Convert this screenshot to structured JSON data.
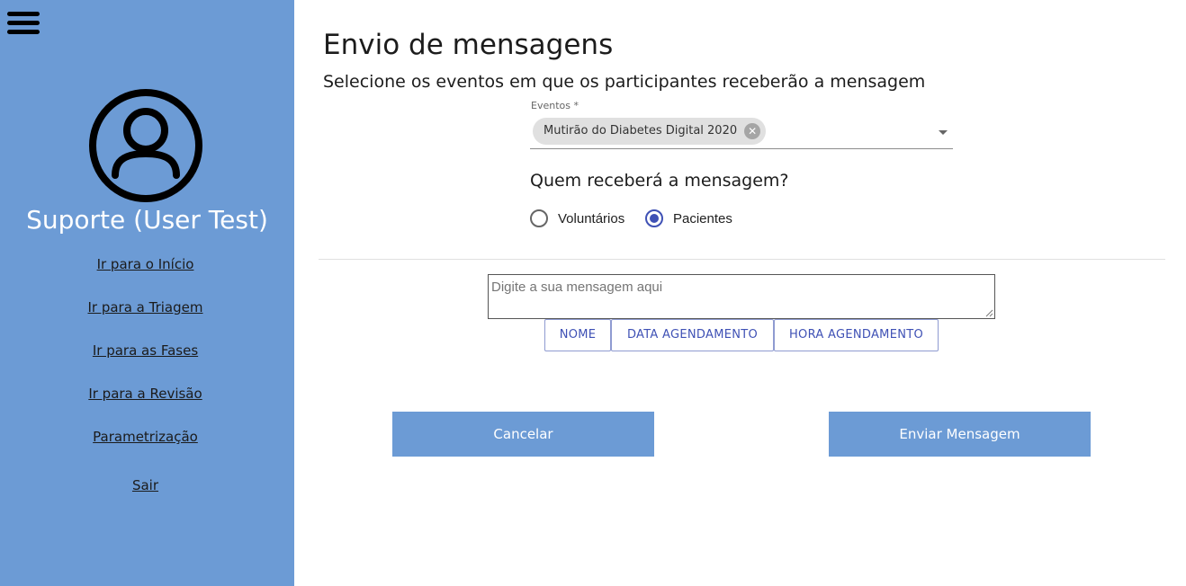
{
  "sidebar": {
    "user_name": "Suporte (User Test)",
    "links": {
      "home": "Ir para o Início",
      "triage": "Ir para a Triagem",
      "phases": "Ir para as Fases",
      "review": "Ir para a Revisão",
      "settings": "Parametrização",
      "logout": "Sair"
    }
  },
  "main": {
    "title": "Envio de mensagens",
    "subtitle": "Selecione os eventos em que os participantes receberão a mensagem",
    "events": {
      "label": "Eventos *",
      "selected": "Mutirão do Diabetes Digital 2020"
    },
    "recipients": {
      "question": "Quem receberá a mensagem?",
      "options": [
        "Voluntários",
        "Pacientes"
      ],
      "selected": "Pacientes"
    },
    "message": {
      "placeholder": "Digite a sua mensagem aqui",
      "value": ""
    },
    "tags": [
      "NOME",
      "DATA AGENDAMENTO",
      "HORA AGENDAMENTO"
    ],
    "buttons": {
      "cancel": "Cancelar",
      "send": "Enviar Mensagem"
    }
  },
  "colors": {
    "sidebar_bg": "#6c9bd5",
    "primary": "#3f51b5",
    "button_bg": "#6c9bd5"
  },
  "icons": [
    "menu-icon",
    "user-avatar-icon",
    "chip-remove-icon",
    "dropdown-arrow-icon"
  ]
}
